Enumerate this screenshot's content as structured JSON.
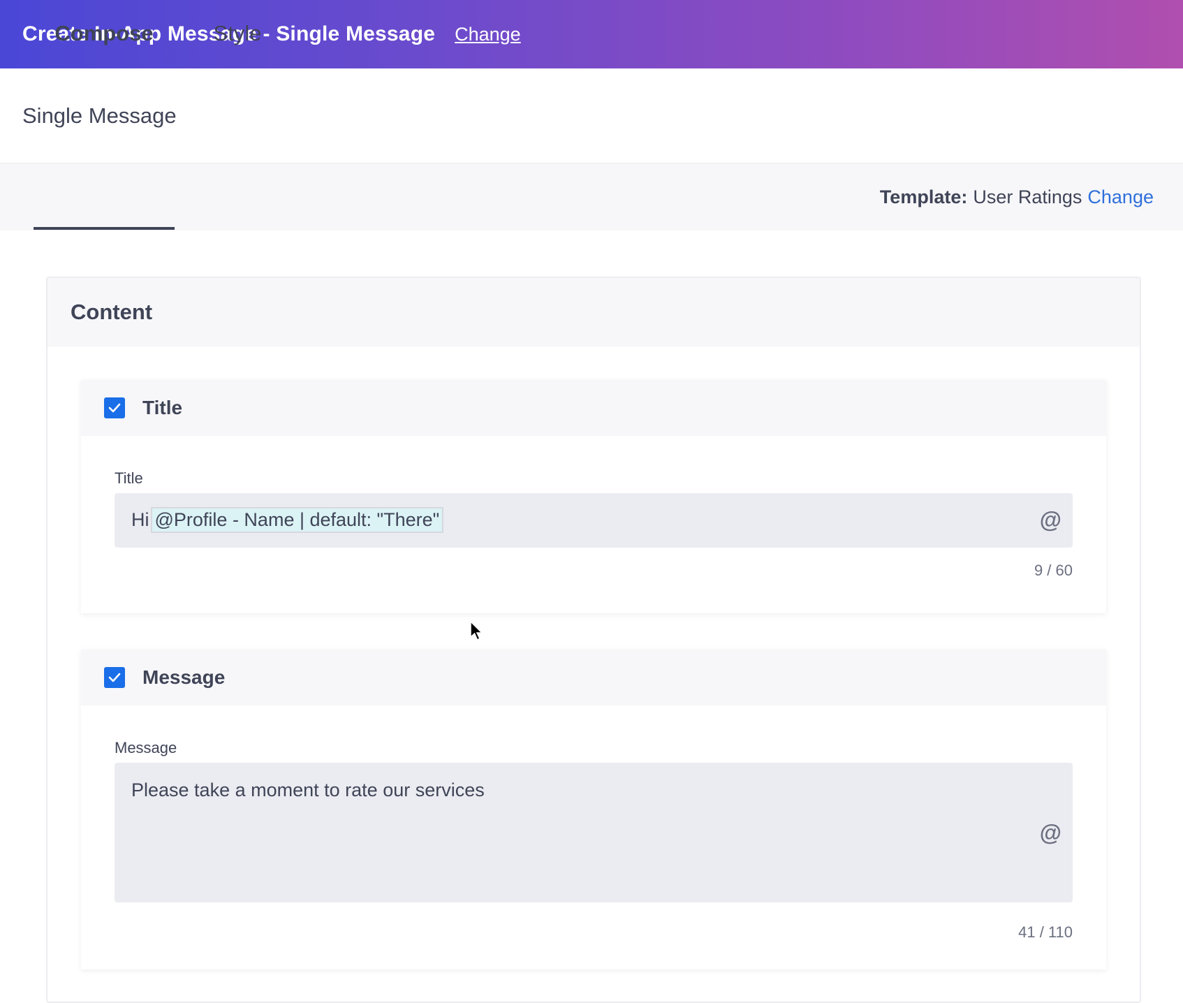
{
  "header": {
    "title": "Create In-App Message - Single Message",
    "change_label": "Change"
  },
  "subheader": {
    "title": "Single Message"
  },
  "tabs": [
    {
      "label": "Compose",
      "active": true
    },
    {
      "label": "Style",
      "active": false
    }
  ],
  "template": {
    "label": "Template:",
    "name": "User Ratings",
    "change_label": "Change"
  },
  "content": {
    "section_title": "Content",
    "title_card": {
      "checkbox_label": "Title",
      "checked": true,
      "field_label": "Title",
      "value_prefix": "Hi",
      "token": "@Profile - Name | default: \"There\"",
      "counter": "9 / 60"
    },
    "message_card": {
      "checkbox_label": "Message",
      "checked": true,
      "field_label": "Message",
      "value": "Please take a moment to rate our services",
      "counter": "41 / 110"
    },
    "at_symbol": "@"
  },
  "colors": {
    "accent": "#1a6ee8",
    "link": "#2f6fdb",
    "header_start": "#4a47d6",
    "header_end": "#b04faf"
  },
  "icons": {
    "checkbox": "check-icon",
    "mention": "at-icon",
    "pointer": "mouse-cursor-icon"
  }
}
